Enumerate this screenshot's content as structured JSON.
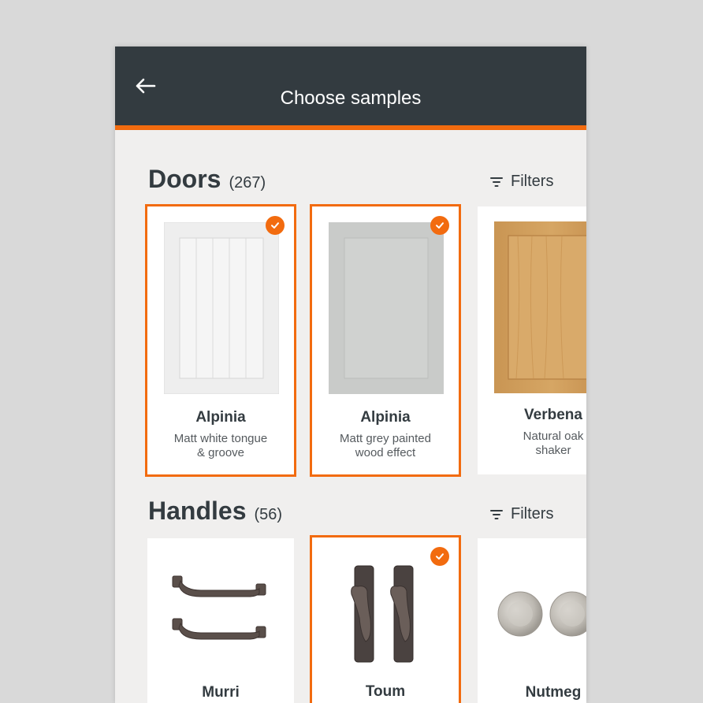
{
  "header": {
    "title": "Choose samples"
  },
  "doors": {
    "title": "Doors",
    "count": "(267)",
    "filters_label": "Filters",
    "items": [
      {
        "name": "Alpinia",
        "desc_line1": "Matt white tongue",
        "desc_line2": "& groove",
        "selected": true
      },
      {
        "name": "Alpinia",
        "desc_line1": "Matt grey painted",
        "desc_line2": "wood effect",
        "selected": true
      },
      {
        "name": "Verbena",
        "desc_line1": "Natural oak",
        "desc_line2": "shaker",
        "selected": false
      }
    ]
  },
  "handles": {
    "title": "Handles",
    "count": "(56)",
    "filters_label": "Filters",
    "items": [
      {
        "name": "Murri",
        "selected": false
      },
      {
        "name": "Toum",
        "selected": true
      },
      {
        "name": "Nutmeg",
        "selected": false
      }
    ]
  },
  "colors": {
    "appbar": "#333b40",
    "accent": "#f26b0f",
    "background": "#f0efee"
  }
}
